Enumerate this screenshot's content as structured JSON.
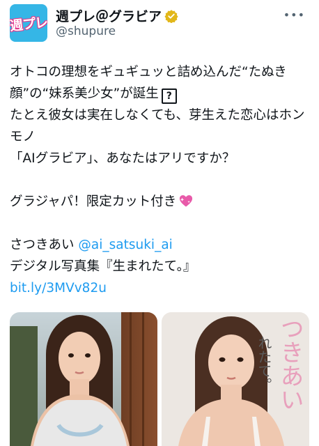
{
  "account": {
    "avatar_text": "週プレ",
    "display_name": "週プレ＠グラビア",
    "handle": "@shupure",
    "more_label": "•••"
  },
  "tweet": {
    "line1": "オトコの理想をギュギュッと詰め込んだ“たぬき",
    "line2": "顔”の“妹系美少女”が誕生",
    "line2_box": "?",
    "line3": "たとえ彼女は実在しなくても、芽生えた恋心はホン",
    "line4": "モノ",
    "line5": "「AIグラビア」、あなたはアリですか？",
    "line6": "グラジャパ！限定カット付き",
    "line7_prefix": "さつきあい ",
    "line7_mention": "@ai_satsuki_ai",
    "line8": "デジタル写真集『生まれたて。』",
    "line9_link": "bit.ly/3MVv82u"
  },
  "media": {
    "right_overlay_main": "つきあい",
    "right_overlay_sub": "れたて。"
  },
  "colors": {
    "link": "#1d9bf0",
    "verified_gold": "#e2b719",
    "secondary_text": "#536471"
  }
}
